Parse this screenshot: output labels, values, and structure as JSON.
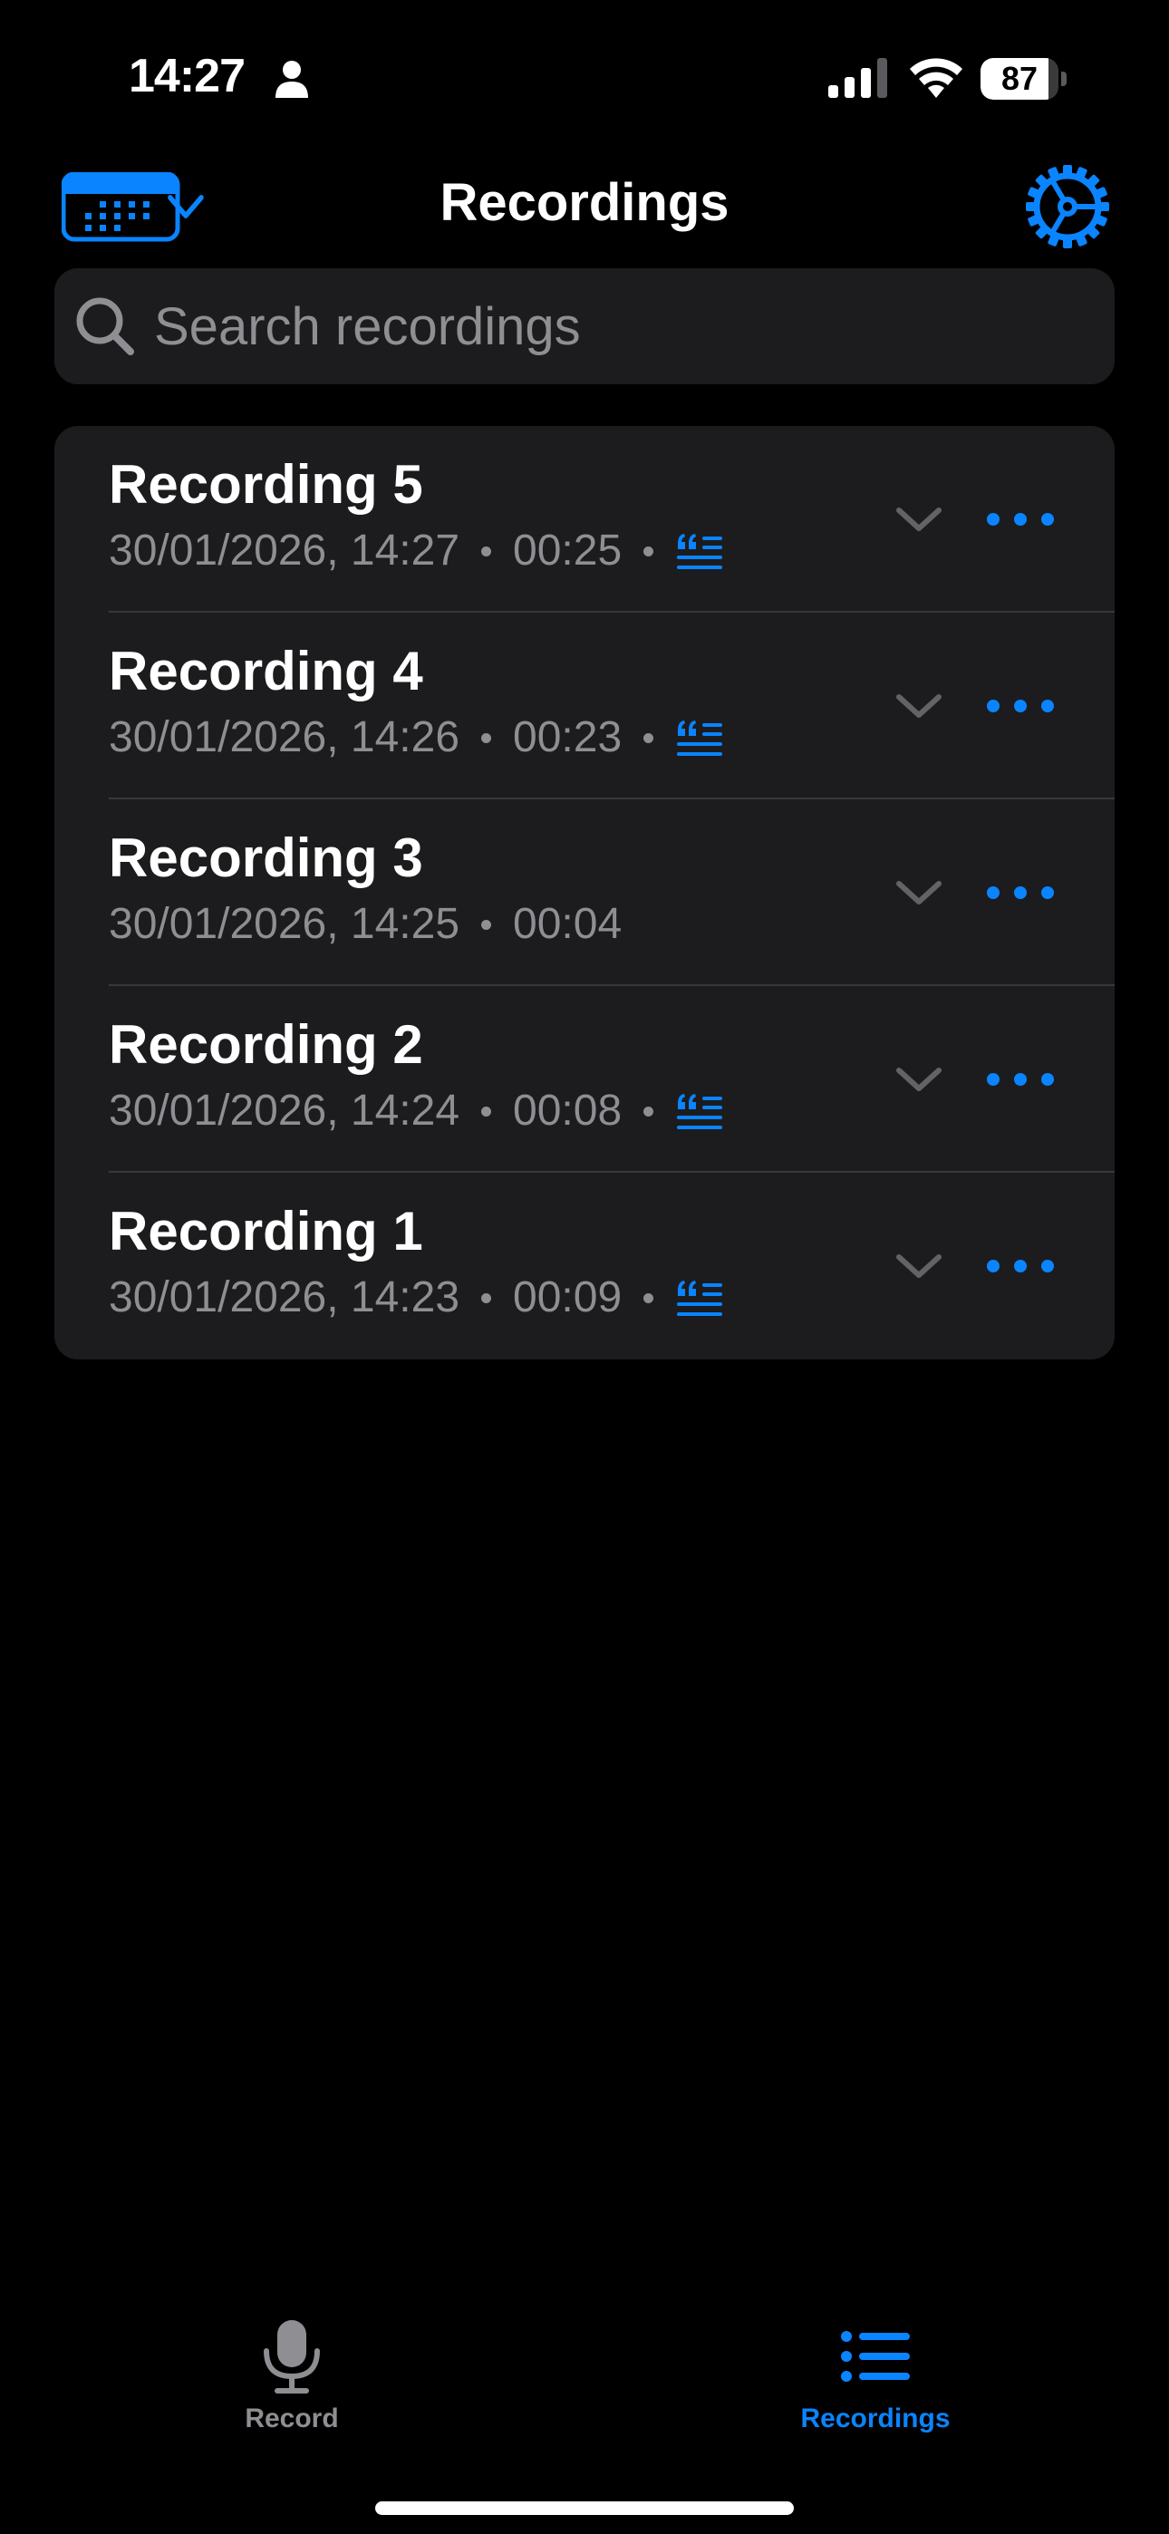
{
  "status_bar": {
    "time": "14:27",
    "battery_level": "87",
    "battery_fraction": 0.87
  },
  "header": {
    "title": "Recordings",
    "calendar_icon": "calendar-icon",
    "settings_icon": "gear-icon"
  },
  "search": {
    "placeholder": "Search recordings",
    "value": ""
  },
  "recordings": [
    {
      "title": "Recording 5",
      "datetime": "30/01/2026, 14:27",
      "duration": "00:25",
      "has_transcript": true
    },
    {
      "title": "Recording 4",
      "datetime": "30/01/2026, 14:26",
      "duration": "00:23",
      "has_transcript": true
    },
    {
      "title": "Recording 3",
      "datetime": "30/01/2026, 14:25",
      "duration": "00:04",
      "has_transcript": false
    },
    {
      "title": "Recording 2",
      "datetime": "30/01/2026, 14:24",
      "duration": "00:08",
      "has_transcript": true
    },
    {
      "title": "Recording 1",
      "datetime": "30/01/2026, 14:23",
      "duration": "00:09",
      "has_transcript": true
    }
  ],
  "tab_bar": {
    "record_label": "Record",
    "recordings_label": "Recordings",
    "active_tab": "recordings"
  },
  "colors": {
    "accent": "#0a84ff",
    "background": "#000000",
    "card": "#1c1c1e",
    "secondary_text": "#8e8e93"
  }
}
